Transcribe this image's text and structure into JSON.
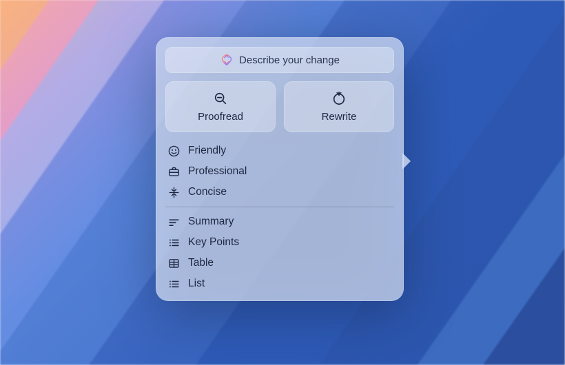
{
  "describe": {
    "placeholder": "Describe your change"
  },
  "actions": {
    "proofread": "Proofread",
    "rewrite": "Rewrite"
  },
  "tones": {
    "friendly": "Friendly",
    "professional": "Professional",
    "concise": "Concise"
  },
  "formats": {
    "summary": "Summary",
    "keypoints": "Key Points",
    "table": "Table",
    "list": "List"
  }
}
